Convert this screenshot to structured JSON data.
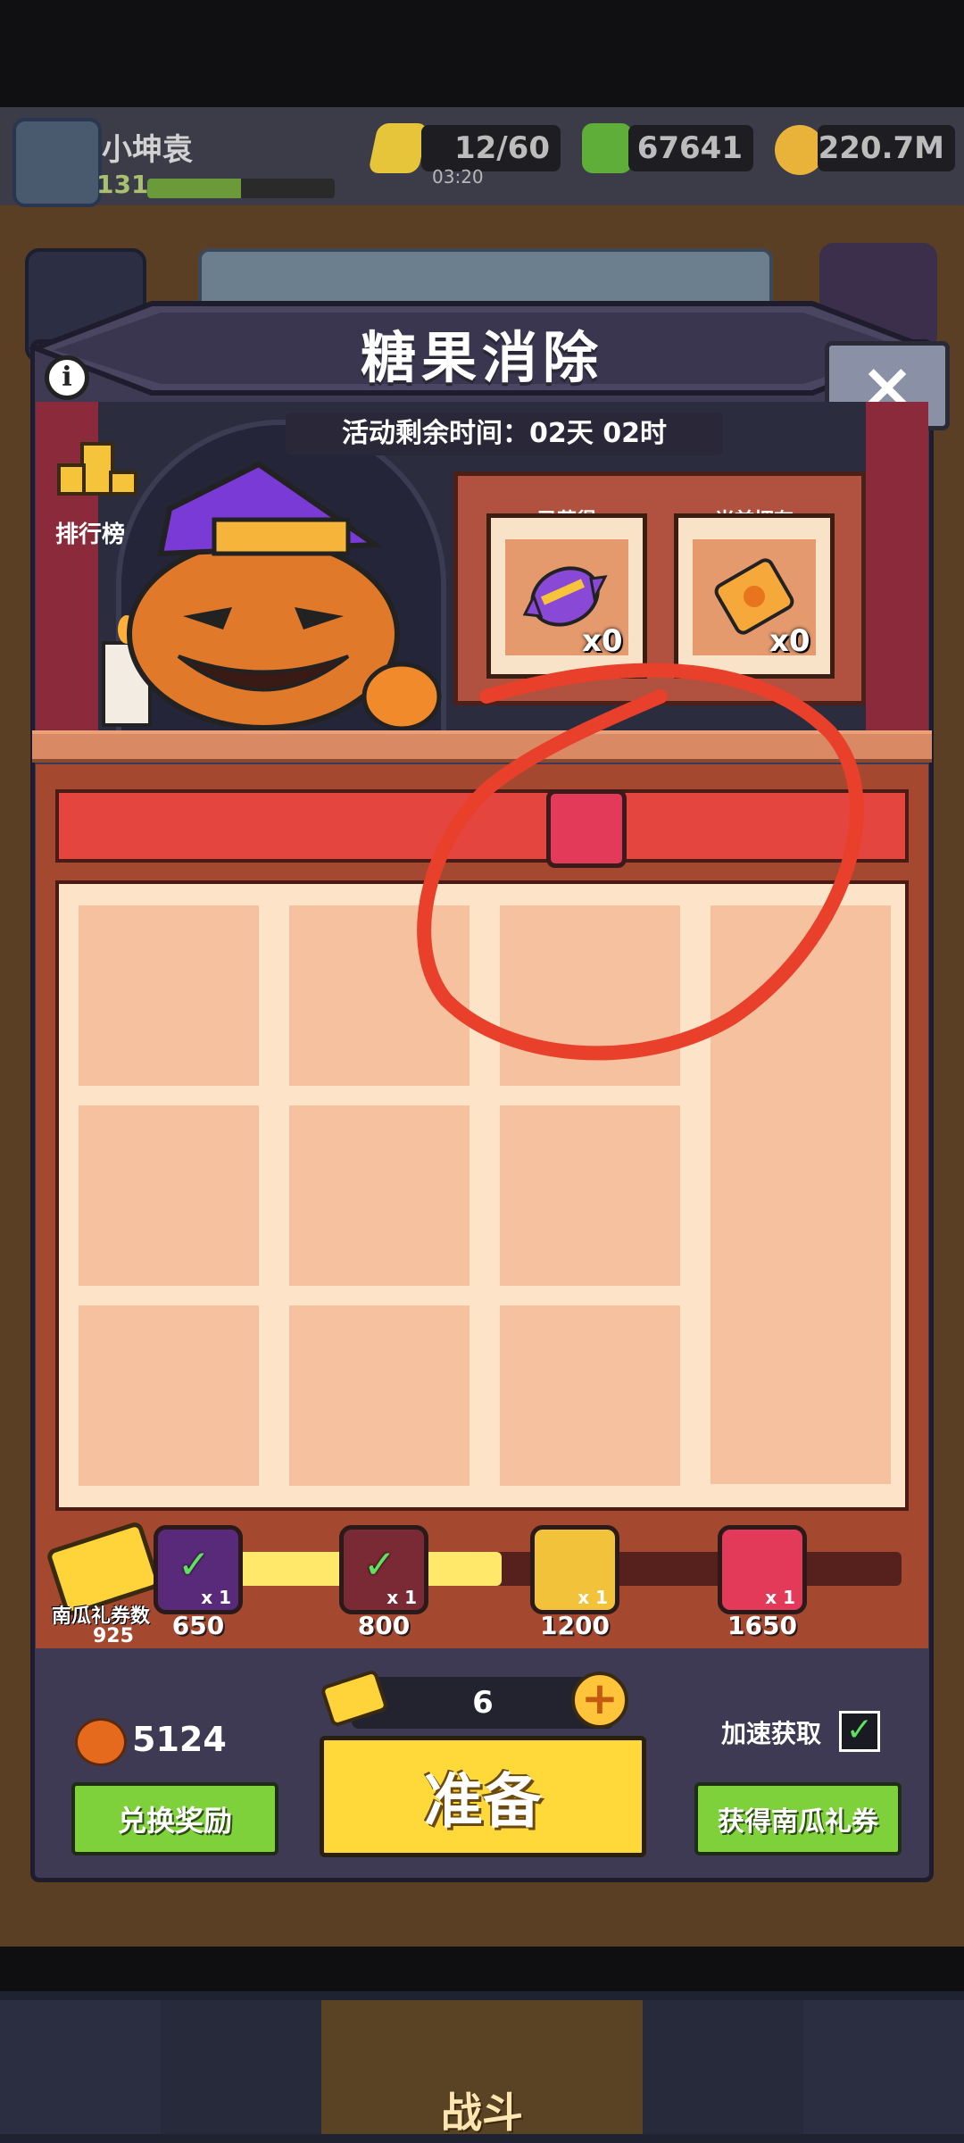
{
  "header": {
    "username": "小坤袁",
    "level": "131",
    "xp_progress": 0.5,
    "energy": "12/60",
    "energy_timer": "03:20",
    "gems": "67641",
    "coins": "220.7M"
  },
  "modal": {
    "title": "糖果消除",
    "time_remaining": "活动剩余时间：02天 02时",
    "ranking_label": "排行榜",
    "earned_label": "已获得",
    "earned_count": "x0",
    "owned_label": "当前拥有",
    "owned_count": "x0",
    "close_icon": "×",
    "info_icon": "i"
  },
  "progress": {
    "ticket_label": "南瓜礼券数",
    "ticket_count": "925",
    "fill_fraction": 0.46,
    "milestones": [
      {
        "value": "650",
        "reward": "x 1",
        "claimed": true
      },
      {
        "value": "800",
        "reward": "x 1",
        "claimed": true
      },
      {
        "value": "1200",
        "reward": "x 1",
        "claimed": false
      },
      {
        "value": "1650",
        "reward": "x 1",
        "claimed": false
      }
    ]
  },
  "bottom": {
    "pumpkins": "5124",
    "exchange_label": "兑换奖励",
    "cost": "6",
    "ready_label": "准备",
    "speed_label": "加速获取",
    "speed_checked": "✓",
    "get_tickets_label": "获得南瓜礼券",
    "plus": "+"
  },
  "nav": {
    "battle_label": "战斗"
  },
  "colors": {
    "accent_red": "#e4463f",
    "accent_yellow": "#ffd93a",
    "accent_green": "#7ed13a",
    "annotation": "#e8402a"
  }
}
